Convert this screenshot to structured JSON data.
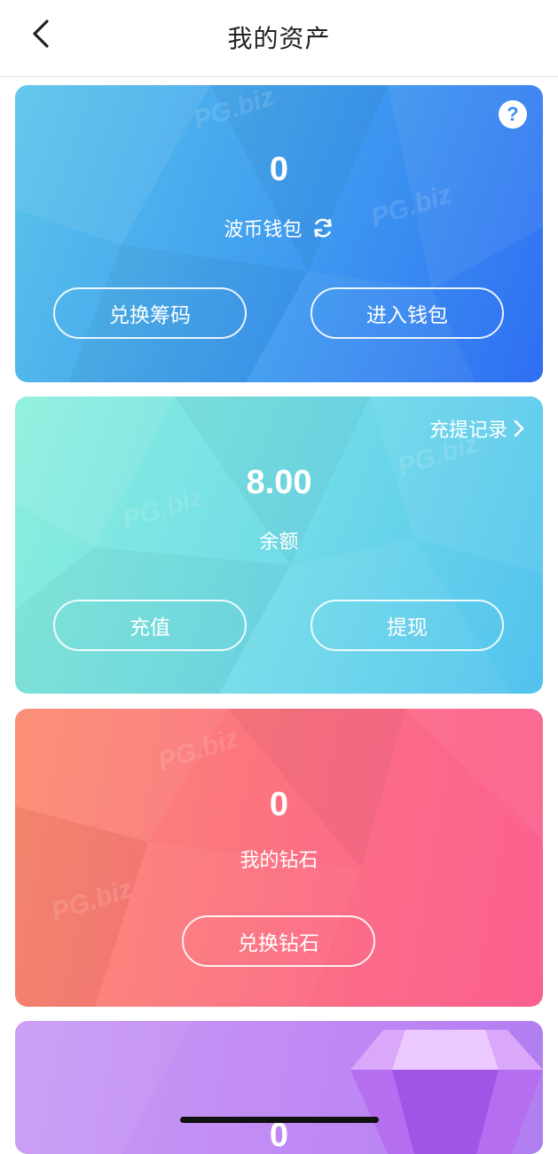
{
  "header": {
    "title": "我的资产"
  },
  "wallet_card": {
    "amount": "0",
    "label": "波币钱包",
    "buttons": {
      "exchange": "兑换筹码",
      "enter": "进入钱包"
    }
  },
  "balance_card": {
    "records_link": "充提记录",
    "amount": "8.00",
    "label": "余额",
    "buttons": {
      "recharge": "充值",
      "withdraw": "提现"
    }
  },
  "diamond_card": {
    "amount": "0",
    "label": "我的钻石",
    "buttons": {
      "exchange": "兑换钻石"
    }
  },
  "fourth_card": {
    "amount": "0"
  },
  "watermark": "PG.biz",
  "colors": {
    "wallet_gradient": [
      "#5ac4ea",
      "#2f6ef2"
    ],
    "balance_gradient": [
      "#8af0dc",
      "#52c2ee"
    ],
    "diamond_gradient": [
      "#fb8a6e",
      "#fb5f90"
    ],
    "fourth_gradient": [
      "#c79af4",
      "#b07ef0"
    ]
  }
}
